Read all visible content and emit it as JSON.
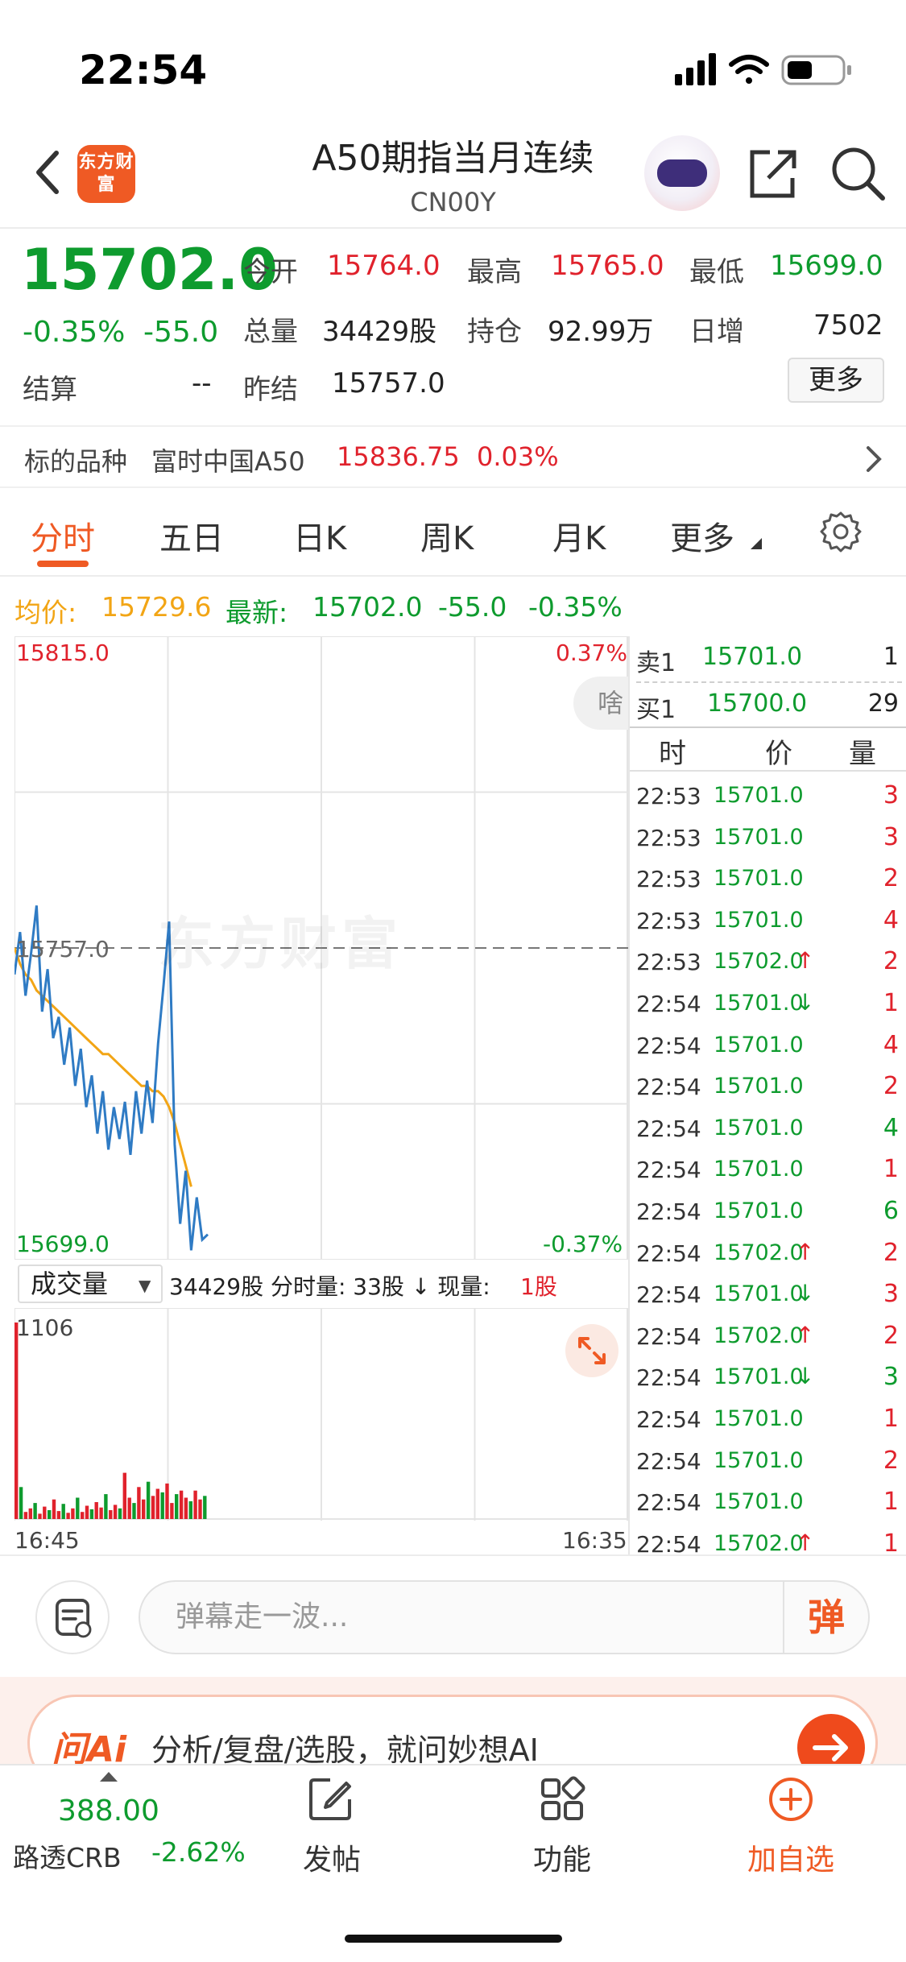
{
  "status": {
    "time": "22:54"
  },
  "header": {
    "logo": "东方财富",
    "title": "A50期指当月连续",
    "subtitle": "CN00Y"
  },
  "quote": {
    "price": "15702.0",
    "pct": "-0.35%",
    "change": "-55.0",
    "open_label": "今开",
    "open": "15764.0",
    "high_label": "最高",
    "high": "15765.0",
    "low_label": "最低",
    "low": "15699.0",
    "volume_label": "总量",
    "volume": "34429股",
    "oi_label": "持仓",
    "oi": "92.99万",
    "daily_inc_label": "日增",
    "daily_inc": "7502",
    "settle_label": "结算",
    "settle": "--",
    "prev_settle_label": "昨结",
    "prev_settle": "15757.0",
    "more_label": "更多"
  },
  "underlying": {
    "label": "标的品种",
    "name": "富时中国A50",
    "price": "15836.75",
    "pct": "0.03%"
  },
  "tabs": [
    {
      "label": "分时"
    },
    {
      "label": "五日"
    },
    {
      "label": "日K"
    },
    {
      "label": "周K"
    },
    {
      "label": "月K"
    },
    {
      "label": "更多"
    }
  ],
  "info_line": {
    "avg_label": "均价:",
    "avg": "15729.6",
    "last_label": "最新:",
    "last": "15702.0",
    "chg": "-55.0",
    "pct": "-0.35%"
  },
  "chart": {
    "high_price": "15815.0",
    "high_pct": "0.37%",
    "low_price": "15699.0",
    "low_pct": "-0.37%",
    "prev_settle": "15757.0",
    "watermark": "东方财富",
    "danmu_chip": "啥",
    "time_start": "16:45",
    "time_end": "16:35",
    "volume_selector": "成交量",
    "volume_info": "34429股 分时量: 33股 ↓ 现量:",
    "volume_now": "1股",
    "volume_max": "1106"
  },
  "chart_data": {
    "type": "line",
    "ylim": [
      15699.0,
      15815.0
    ],
    "baseline": 15757.0,
    "series": [
      {
        "values": [
          15752,
          15760,
          15748,
          15756,
          15765,
          15745,
          15753,
          15740,
          15744,
          15735,
          15742,
          15731,
          15738,
          15727,
          15733,
          15722,
          15730,
          15719,
          15727,
          15721,
          15728,
          15718,
          15730,
          15722,
          15732,
          15724,
          15739,
          15750,
          15762,
          15720,
          15705,
          15715,
          15700,
          15710,
          15702,
          15703
        ]
      },
      {
        "values": [
          15757,
          15754,
          15752,
          15751,
          15749,
          15748,
          15747,
          15746,
          15745,
          15744,
          15743,
          15742,
          15741,
          15740,
          15739,
          15738,
          15737,
          15737,
          15736,
          15735,
          15734,
          15733,
          15732,
          15731,
          15731,
          15730,
          15730,
          15729,
          15727,
          15724,
          15720,
          15716,
          15712
        ]
      }
    ],
    "volume": [
      1106,
      180,
      40,
      60,
      90,
      30,
      70,
      50,
      110,
      45,
      85,
      35,
      60,
      120,
      40,
      75,
      55,
      95,
      65,
      140,
      50,
      80,
      60,
      260,
      120,
      90,
      180,
      110,
      210,
      130,
      170,
      150,
      200,
      90,
      140,
      160,
      120,
      100,
      160,
      110,
      130
    ]
  },
  "order_book": {
    "ask_label": "卖1",
    "ask_price": "15701.0",
    "ask_vol": "1",
    "bid_label": "买1",
    "bid_price": "15700.0",
    "bid_vol": "29",
    "head_time": "时",
    "head_price": "价",
    "head_vol": "量"
  },
  "ticks": [
    {
      "t": "22:53",
      "p": "15701.0",
      "a": "",
      "v": "3",
      "c": "#e0222c"
    },
    {
      "t": "22:53",
      "p": "15701.0",
      "a": "",
      "v": "3",
      "c": "#e0222c"
    },
    {
      "t": "22:53",
      "p": "15701.0",
      "a": "",
      "v": "2",
      "c": "#e0222c"
    },
    {
      "t": "22:53",
      "p": "15701.0",
      "a": "",
      "v": "4",
      "c": "#e0222c"
    },
    {
      "t": "22:53",
      "p": "15702.0",
      "a": "↑",
      "v": "2",
      "c": "#e0222c"
    },
    {
      "t": "22:54",
      "p": "15701.0",
      "a": "↓",
      "v": "1",
      "c": "#e0222c"
    },
    {
      "t": "22:54",
      "p": "15701.0",
      "a": "",
      "v": "4",
      "c": "#e0222c"
    },
    {
      "t": "22:54",
      "p": "15701.0",
      "a": "",
      "v": "2",
      "c": "#e0222c"
    },
    {
      "t": "22:54",
      "p": "15701.0",
      "a": "",
      "v": "4",
      "c": "#0e9b2e"
    },
    {
      "t": "22:54",
      "p": "15701.0",
      "a": "",
      "v": "1",
      "c": "#e0222c"
    },
    {
      "t": "22:54",
      "p": "15701.0",
      "a": "",
      "v": "6",
      "c": "#0e9b2e"
    },
    {
      "t": "22:54",
      "p": "15702.0",
      "a": "↑",
      "v": "2",
      "c": "#e0222c"
    },
    {
      "t": "22:54",
      "p": "15701.0",
      "a": "↓",
      "v": "3",
      "c": "#e0222c"
    },
    {
      "t": "22:54",
      "p": "15702.0",
      "a": "↑",
      "v": "2",
      "c": "#e0222c"
    },
    {
      "t": "22:54",
      "p": "15701.0",
      "a": "↓",
      "v": "3",
      "c": "#0e9b2e"
    },
    {
      "t": "22:54",
      "p": "15701.0",
      "a": "",
      "v": "1",
      "c": "#e0222c"
    },
    {
      "t": "22:54",
      "p": "15701.0",
      "a": "",
      "v": "2",
      "c": "#e0222c"
    },
    {
      "t": "22:54",
      "p": "15701.0",
      "a": "",
      "v": "1",
      "c": "#e0222c"
    },
    {
      "t": "22:54",
      "p": "15702.0",
      "a": "↑",
      "v": "1",
      "c": "#e0222c"
    }
  ],
  "danmu": {
    "placeholder": "弹幕走一波...",
    "send": "弹"
  },
  "ai_banner": {
    "logo": "问Ai",
    "text": "分析/复盘/选股，就问妙想AI"
  },
  "bottom_nav": {
    "crb_value": "388.00",
    "crb_label": "路透CRB",
    "crb_pct": "-2.62%",
    "post": "发帖",
    "func": "功能",
    "add": "加自选"
  }
}
